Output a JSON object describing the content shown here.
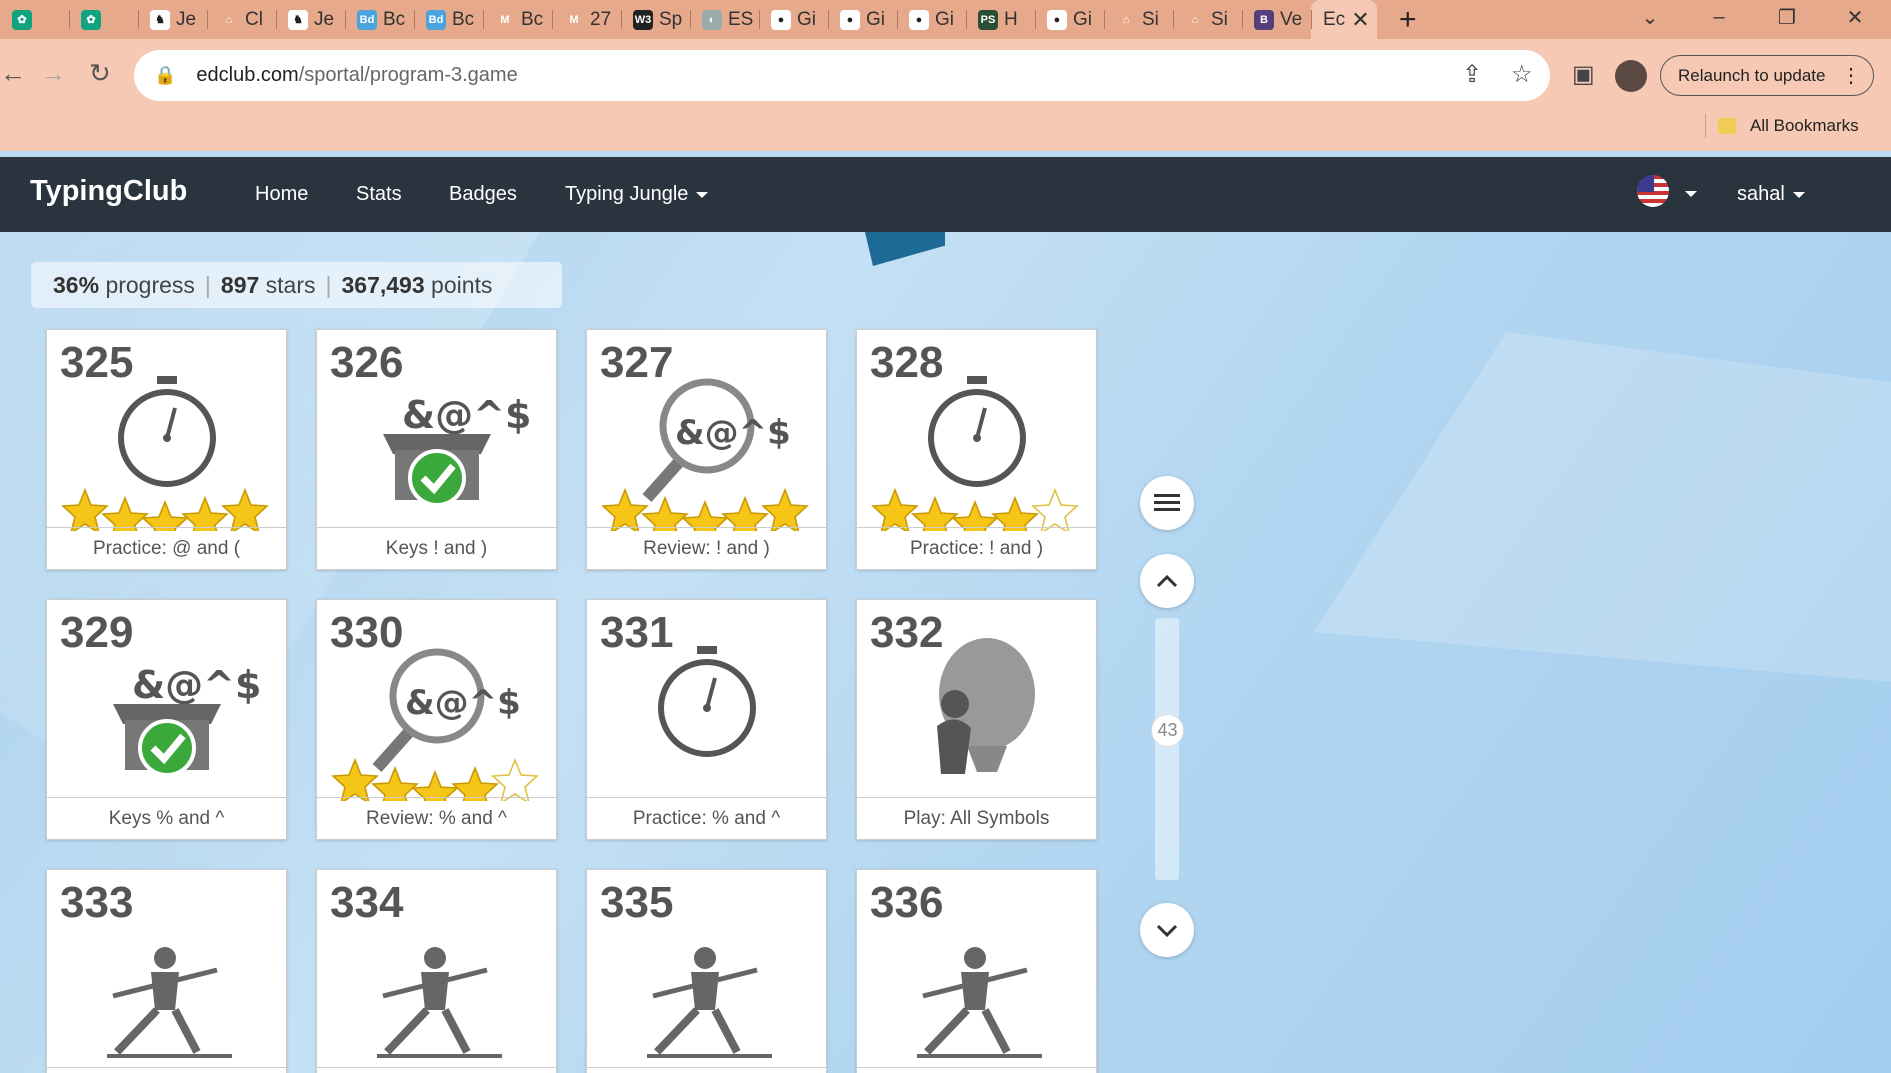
{
  "browser": {
    "tabs": [
      {
        "icon": "chatgpt-icon",
        "title": ""
      },
      {
        "icon": "chatgpt-icon",
        "title": ""
      },
      {
        "icon": "jest-icon",
        "title": "Je"
      },
      {
        "icon": "codepen-icon",
        "title": "Cl"
      },
      {
        "icon": "jest-icon",
        "title": "Je"
      },
      {
        "icon": "bd-icon",
        "title": "Bc"
      },
      {
        "icon": "bd-icon",
        "title": "Bc"
      },
      {
        "icon": "mdb-icon",
        "title": "Bc"
      },
      {
        "icon": "mdb-icon",
        "title": "27"
      },
      {
        "icon": "w3-icon",
        "title": "Sp"
      },
      {
        "icon": "globe-icon",
        "title": "ES"
      },
      {
        "icon": "github-icon",
        "title": "Gi"
      },
      {
        "icon": "github-icon",
        "title": "Gi"
      },
      {
        "icon": "github-icon",
        "title": "Gi"
      },
      {
        "icon": "ps-icon",
        "title": "H"
      },
      {
        "icon": "github-icon",
        "title": "Gi"
      },
      {
        "icon": "codepen-icon",
        "title": "Si"
      },
      {
        "icon": "codepen-icon",
        "title": "Si"
      },
      {
        "icon": "bootstrap-icon",
        "title": "Ve"
      }
    ],
    "active_tab": {
      "title": "Ec",
      "close": "✕"
    },
    "new_tab": "+",
    "url_host": "edclub.com",
    "url_path": "/sportal/program-3.game",
    "relaunch_label": "Relaunch to update",
    "bookmarks_label": "All Bookmarks"
  },
  "site": {
    "logo": "TypingClub",
    "nav": {
      "home": "Home",
      "stats": "Stats",
      "badges": "Badges",
      "jungle": "Typing Jungle"
    },
    "user": "sahal"
  },
  "progress": {
    "percent": "36%",
    "percent_label": "progress",
    "stars": "897",
    "stars_label": "stars",
    "points": "367,493",
    "points_label": "points"
  },
  "lessons": [
    {
      "num": "325",
      "label": "Practice: @ and (",
      "kind": "stopwatch",
      "stars": 5
    },
    {
      "num": "326",
      "label": "Keys ! and )",
      "kind": "box",
      "stars": 0
    },
    {
      "num": "327",
      "label": "Review: ! and )",
      "kind": "magnifier",
      "stars": 5
    },
    {
      "num": "328",
      "label": "Practice: ! and )",
      "kind": "stopwatch",
      "stars": 4
    },
    {
      "num": "329",
      "label": "Keys % and ^",
      "kind": "box",
      "stars": 0
    },
    {
      "num": "330",
      "label": "Review: % and ^",
      "kind": "magnifier",
      "stars": 4
    },
    {
      "num": "331",
      "label": "Practice: % and ^",
      "kind": "stopwatch",
      "stars": 0
    },
    {
      "num": "332",
      "label": "Play: All Symbols",
      "kind": "balloon",
      "stars": 0
    },
    {
      "num": "333",
      "label": "",
      "kind": "yoga",
      "stars": 0
    },
    {
      "num": "334",
      "label": "",
      "kind": "yoga",
      "stars": 0
    },
    {
      "num": "335",
      "label": "",
      "kind": "yoga",
      "stars": 0
    },
    {
      "num": "336",
      "label": "",
      "kind": "yoga",
      "stars": 0
    }
  ],
  "scroll": {
    "page": "43"
  },
  "colors": {
    "header": "#29343f",
    "star": "#f5c518",
    "check": "#3aa83a",
    "tabbar": "#e7a98c"
  }
}
